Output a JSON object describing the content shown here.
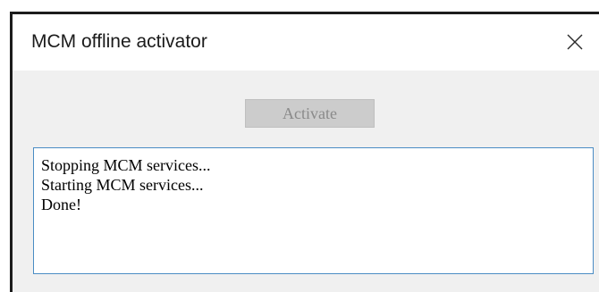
{
  "window": {
    "title": "MCM offline activator"
  },
  "toolbar": {
    "activate_label": "Activate",
    "activate_enabled": false
  },
  "log": {
    "lines": [
      "Stopping MCM services...",
      "Starting MCM services...",
      "Done!"
    ]
  },
  "icons": {
    "close": "close-icon"
  },
  "colors": {
    "window_background": "#f0f0f0",
    "titlebar_background": "#ffffff",
    "log_border": "#4a8cc4",
    "disabled_button_background": "#cccccc",
    "disabled_button_text": "#8a8a8a"
  }
}
